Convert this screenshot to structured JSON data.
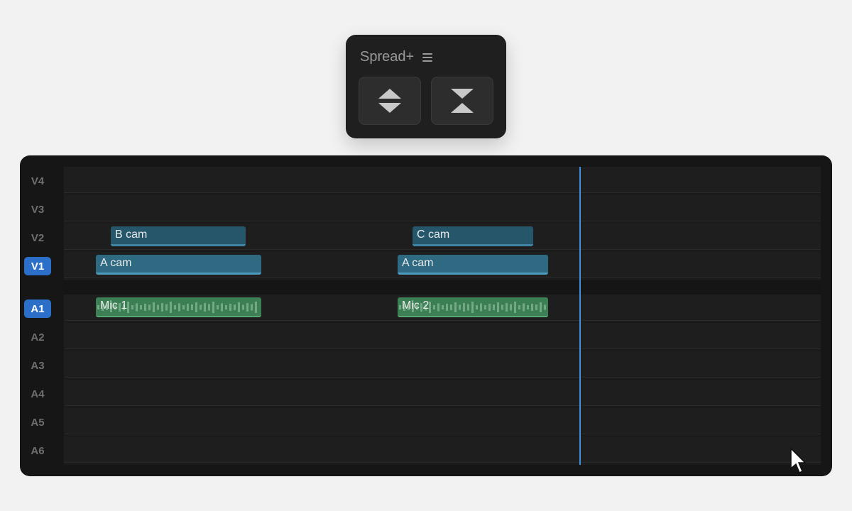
{
  "panel": {
    "title": "Spread+",
    "menu_icon": "hamburger-menu-icon",
    "buttons": [
      {
        "name": "spread-button",
        "icon": "expand-vertical-icon"
      },
      {
        "name": "collapse-button",
        "icon": "collapse-vertical-icon"
      }
    ]
  },
  "timeline": {
    "video_tracks": [
      {
        "label": "V4",
        "active": false
      },
      {
        "label": "V3",
        "active": false
      },
      {
        "label": "V2",
        "active": false
      },
      {
        "label": "V1",
        "active": true
      }
    ],
    "audio_tracks": [
      {
        "label": "A1",
        "active": true
      },
      {
        "label": "A2",
        "active": false
      },
      {
        "label": "A3",
        "active": false
      },
      {
        "label": "A4",
        "active": false
      },
      {
        "label": "A5",
        "active": false
      },
      {
        "label": "A6",
        "active": false
      }
    ],
    "clips": {
      "v2_clip_1": "B cam",
      "v2_clip_2": "C cam",
      "v1_clip_1": "A cam",
      "v1_clip_2": "A cam",
      "a1_clip_1": "Mic 1",
      "a1_clip_2": "Mic 2"
    }
  },
  "colors": {
    "accent": "#2b6fc9",
    "playhead": "#3d8fe0",
    "video_clip": "#2e6a82",
    "audio_clip": "#3d7f55"
  }
}
